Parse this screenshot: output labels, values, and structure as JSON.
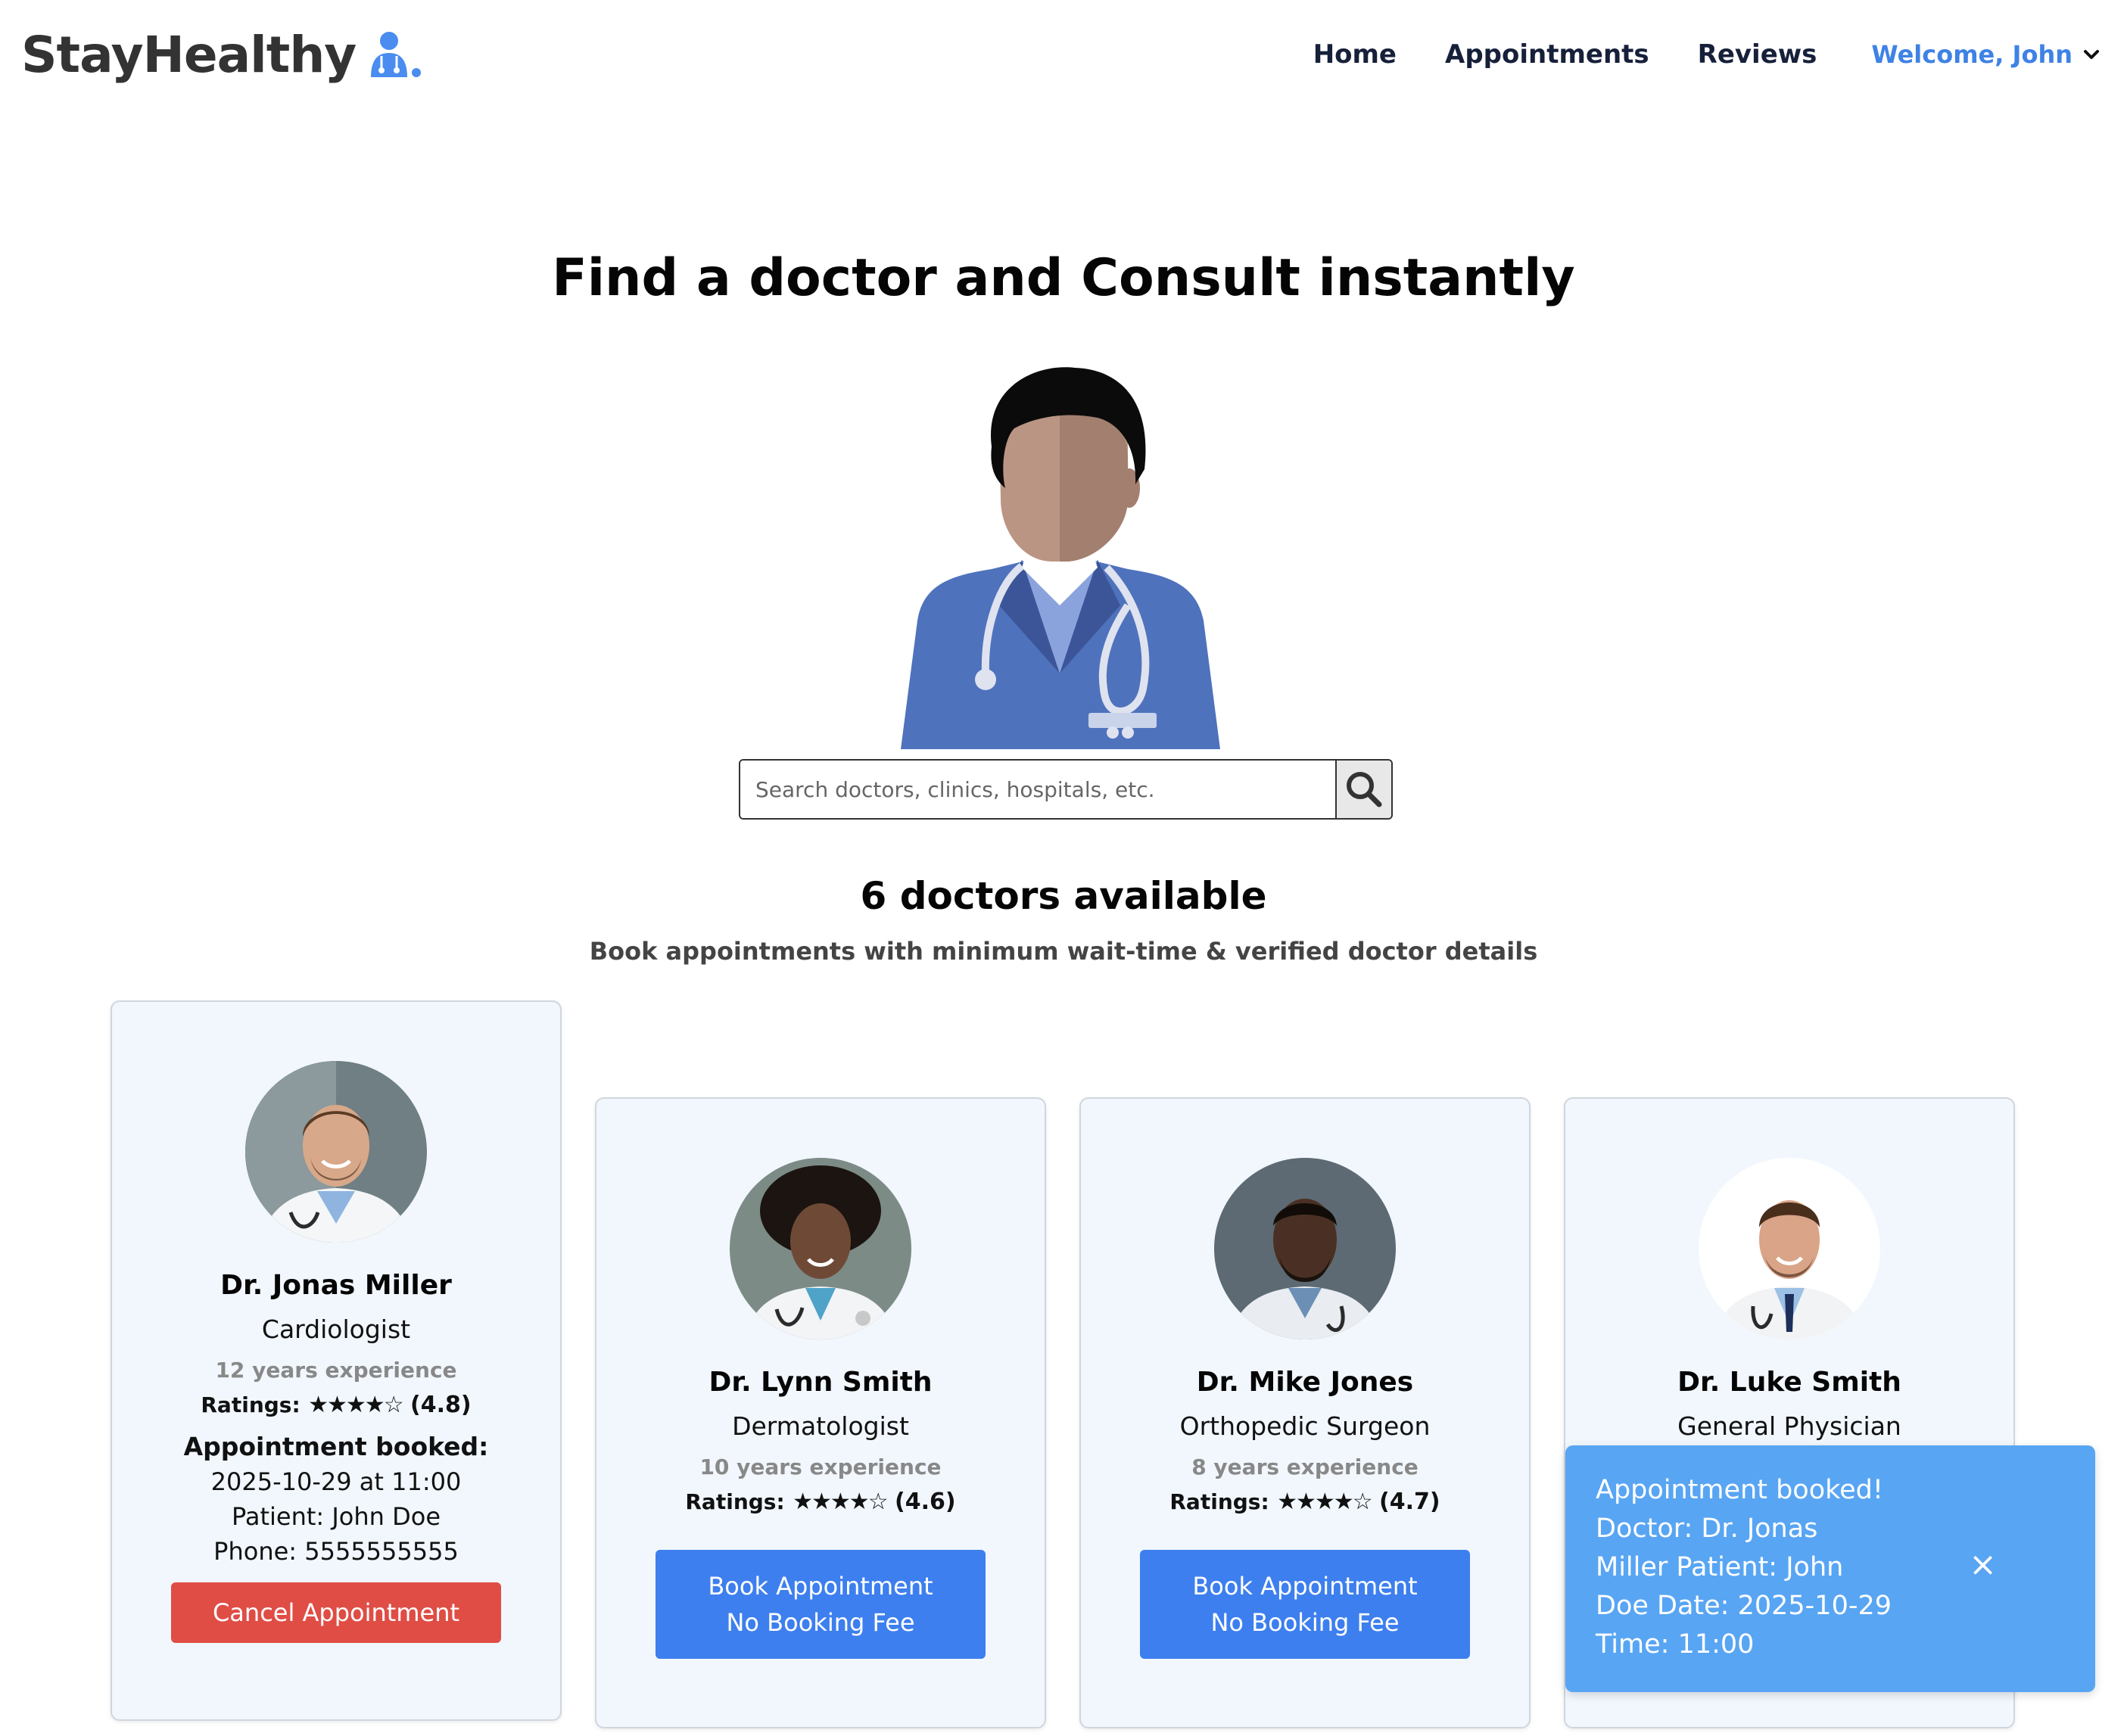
{
  "brand": {
    "name": "StayHealthy",
    "accent": "#3f82e6"
  },
  "nav": {
    "links": [
      "Home",
      "Appointments",
      "Reviews"
    ],
    "welcome": "Welcome, John"
  },
  "hero": {
    "title": "Find a doctor and Consult instantly"
  },
  "search": {
    "placeholder": "Search doctors, clinics, hospitals, etc.",
    "value": ""
  },
  "results": {
    "count_title": "6 doctors available",
    "subtitle": "Book appointments with minimum wait-time & verified doctor details"
  },
  "doctors": [
    {
      "name": "Dr. Jonas Miller",
      "speciality": "Cardiologist",
      "experience": "12 years experience",
      "ratings_label": "Ratings:",
      "stars": "★★★★☆",
      "rating_value": "(4.8)",
      "booked": true,
      "booked_title": "Appointment booked:",
      "booked_datetime": "2025-10-29 at 11:00",
      "booked_patient": "Patient: John Doe",
      "booked_phone": "Phone: 5555555555",
      "action_label": "Cancel Appointment"
    },
    {
      "name": "Dr. Lynn Smith",
      "speciality": "Dermatologist",
      "experience": "10 years experience",
      "ratings_label": "Ratings:",
      "stars": "★★★★☆",
      "rating_value": "(4.6)",
      "action_label": "Book Appointment",
      "action_sub": "No Booking Fee"
    },
    {
      "name": "Dr. Mike Jones",
      "speciality": "Orthopedic Surgeon",
      "experience": "8 years experience",
      "ratings_label": "Ratings:",
      "stars": "★★★★☆",
      "rating_value": "(4.7)",
      "action_label": "Book Appointment",
      "action_sub": "No Booking Fee"
    },
    {
      "name": "Dr. Luke Smith",
      "speciality": "General Physician"
    }
  ],
  "toast": {
    "lines": [
      "Appointment booked!",
      "Doctor: Dr. Jonas",
      "Miller Patient: John",
      "Doe Date: 2025-10-29",
      "Time: 11:00"
    ],
    "close": "×"
  },
  "colors": {
    "card_bg": "#f1f7fd",
    "book_button": "#3d7fee",
    "cancel_button": "#df4d45",
    "toast_bg": "#58a5f3"
  }
}
